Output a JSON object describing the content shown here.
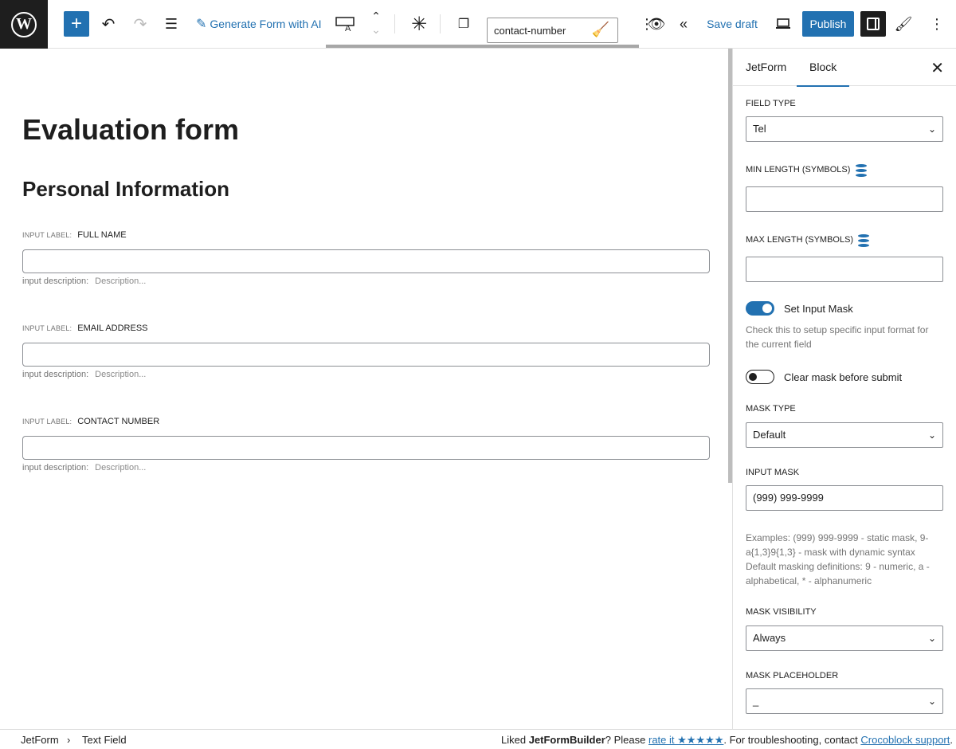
{
  "toolbar": {
    "add_icon": "plus-icon",
    "generate_ai_label": "Generate Form with AI",
    "block_name_value": "contact-number",
    "save_draft_label": "Save draft",
    "publish_label": "Publish"
  },
  "canvas": {
    "form_title": "Evaluation form",
    "section_title": "Personal Information",
    "fields": [
      {
        "label_prefix": "INPUT LABEL:",
        "label": "FULL NAME",
        "desc_prefix": "input description:",
        "desc": "Description..."
      },
      {
        "label_prefix": "INPUT LABEL:",
        "label": "EMAIL ADDRESS",
        "desc_prefix": "input description:",
        "desc": "Description..."
      },
      {
        "label_prefix": "INPUT LABEL:",
        "label": "CONTACT NUMBER",
        "desc_prefix": "input description:",
        "desc": "Description..."
      }
    ]
  },
  "sidebar": {
    "tabs": [
      "JetForm",
      "Block"
    ],
    "active_tab": "Block",
    "field_type_label": "FIELD TYPE",
    "field_type_value": "Tel",
    "min_length_label": "MIN LENGTH (SYMBOLS)",
    "min_length_value": "",
    "max_length_label": "MAX LENGTH (SYMBOLS)",
    "max_length_value": "",
    "set_mask_label": "Set Input Mask",
    "set_mask_on": true,
    "set_mask_help": "Check this to setup specific input format for the current field",
    "clear_mask_label": "Clear mask before submit",
    "clear_mask_on": false,
    "mask_type_label": "MASK TYPE",
    "mask_type_value": "Default",
    "input_mask_label": "INPUT MASK",
    "input_mask_value": "(999) 999-9999",
    "mask_help": "Examples: (999) 999-9999 - static mask, 9-a{1,3}9{1,3} - mask with dynamic syntax Default masking definitions: 9 - numeric, a - alphabetical, * - alphanumeric",
    "mask_visibility_label": "MASK VISIBILITY",
    "mask_visibility_value": "Always",
    "mask_placeholder_label": "MASK PLACEHOLDER",
    "mask_placeholder_value": "_"
  },
  "footer": {
    "breadcrumb_root": "JetForm",
    "breadcrumb_sep": "›",
    "breadcrumb_current": "Text Field",
    "note_prefix": "Liked ",
    "note_brand": "JetFormBuilder",
    "note_mid": "? Please ",
    "note_rate_link": "rate it ★★★★★",
    "note_mid2": ". For troubleshooting, contact ",
    "note_support_link": "Crocoblock support",
    "note_end": "."
  },
  "colors": {
    "accent": "#2271b1",
    "dark": "#1e1e1e"
  }
}
